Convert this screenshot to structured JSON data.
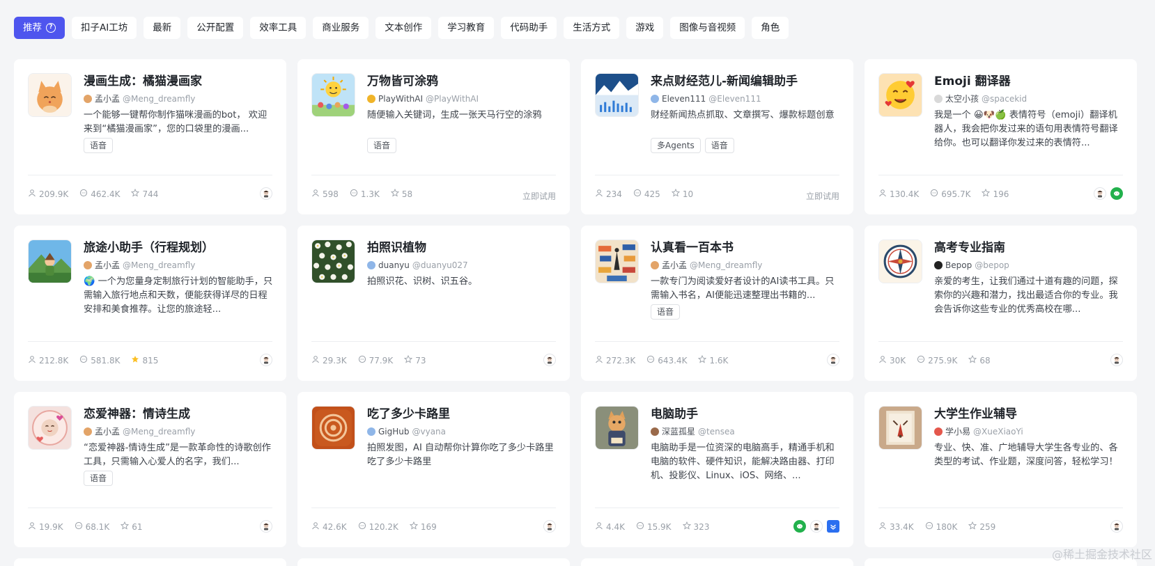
{
  "tabs": [
    {
      "label": "推荐",
      "active": true,
      "icon": "question-icon"
    },
    {
      "label": "扣子AI工坊"
    },
    {
      "label": "最新"
    },
    {
      "label": "公开配置"
    },
    {
      "label": "效率工具"
    },
    {
      "label": "商业服务"
    },
    {
      "label": "文本创作"
    },
    {
      "label": "学习教育"
    },
    {
      "label": "代码助手"
    },
    {
      "label": "生活方式"
    },
    {
      "label": "游戏"
    },
    {
      "label": "图像与音视频"
    },
    {
      "label": "角色"
    }
  ],
  "cards": [
    {
      "title": "漫画生成：橘猫漫画家",
      "author": "孟小孟",
      "handle": "@Meng_dreamfly",
      "desc": "一个能够一键帮你制作猫咪漫画的bot， 欢迎来到“橘猫漫画家”，您的口袋里的漫画...",
      "tags": [
        "语音"
      ],
      "users": "209.9K",
      "chats": "462.4K",
      "stars": "744",
      "starred": false,
      "try": "",
      "channels": [
        "robot"
      ],
      "thumb": "cat"
    },
    {
      "title": "万物皆可涂鸦",
      "author": "PlayWithAI",
      "handle": "@PlayWithAI",
      "desc": "随便输入关键词，生成一张天马行空的涂鸦",
      "tags": [
        "语音"
      ],
      "users": "598",
      "chats": "1.3K",
      "stars": "58",
      "starred": false,
      "try": "立即试用",
      "channels": [],
      "thumb": "doodle"
    },
    {
      "title": "来点财经范儿-新闻编辑助手",
      "author": "Eleven111",
      "handle": "@Eleven111",
      "desc": "财经新闻热点抓取、文章撰写、爆款标题创意",
      "tags": [
        "多Agents",
        "语音"
      ],
      "users": "234",
      "chats": "425",
      "stars": "10",
      "starred": false,
      "try": "立即试用",
      "channels": [],
      "thumb": "finance"
    },
    {
      "title": "Emoji 翻译器",
      "author": "太空小孩",
      "handle": "@spacekid",
      "desc": "我是一个 😀🐶🍏 表情符号（emoji）翻译机器人，我会把你发过来的语句用表情符号翻译给你。也可以翻译你发过来的表情符...",
      "tags": [],
      "users": "130.4K",
      "chats": "695.7K",
      "stars": "196",
      "starred": false,
      "try": "",
      "channels": [
        "robot",
        "wechat"
      ],
      "thumb": "emoji"
    },
    {
      "title": "旅途小助手（行程规划）",
      "author": "孟小孟",
      "handle": "@Meng_dreamfly",
      "desc": "🌍 一个为您量身定制旅行计划的智能助手，只需输入旅行地点和天数，便能获得详尽的日程安排和美食推荐。让您的旅途轻...",
      "tags": [],
      "users": "212.8K",
      "chats": "581.8K",
      "stars": "815",
      "starred": true,
      "try": "",
      "channels": [
        "robot"
      ],
      "thumb": "travel"
    },
    {
      "title": "拍照识植物",
      "author": "duanyu",
      "handle": "@duanyu027",
      "desc": "拍照识花、识树、识五谷。",
      "tags": [],
      "users": "29.3K",
      "chats": "77.9K",
      "stars": "73",
      "starred": false,
      "try": "",
      "channels": [
        "robot"
      ],
      "thumb": "plant"
    },
    {
      "title": "认真看一百本书",
      "author": "孟小孟",
      "handle": "@Meng_dreamfly",
      "desc": "一款专门为阅读爱好者设计的AI读书工具。只需输入书名，AI便能迅速整理出书籍的...",
      "tags": [
        "语音"
      ],
      "users": "272.3K",
      "chats": "643.4K",
      "stars": "1.6K",
      "starred": false,
      "try": "",
      "channels": [
        "robot"
      ],
      "thumb": "books"
    },
    {
      "title": "高考专业指南",
      "author": "Bepop",
      "handle": "@bepop",
      "desc": "亲爱的考生，让我们通过十道有趣的问题，探索你的兴趣和潜力，找出最适合你的专业。我会告诉你这些专业的优秀高校在哪...",
      "tags": [],
      "users": "30K",
      "chats": "275.9K",
      "stars": "68",
      "starred": false,
      "try": "",
      "channels": [
        "robot"
      ],
      "thumb": "compass"
    },
    {
      "title": "恋爱神器：情诗生成",
      "author": "孟小孟",
      "handle": "@Meng_dreamfly",
      "desc": "“恋爱神器-情诗生成”是一款革命性的诗歌创作工具，只需输入心爱人的名字，我们...",
      "tags": [
        "语音"
      ],
      "users": "19.9K",
      "chats": "68.1K",
      "stars": "61",
      "starred": false,
      "try": "",
      "channels": [
        "robot"
      ],
      "thumb": "love"
    },
    {
      "title": "吃了多少卡路里",
      "author": "GigHub",
      "handle": "@vyana",
      "desc": "拍照发图，AI 自动帮你计算你吃了多少卡路里 吃了多少卡路里",
      "tags": [],
      "users": "42.6K",
      "chats": "120.2K",
      "stars": "169",
      "starred": false,
      "try": "",
      "channels": [
        "robot"
      ],
      "thumb": "calorie"
    },
    {
      "title": "电脑助手",
      "author": "深蓝孤星",
      "handle": "@tensea",
      "desc": "电脑助手是一位资深的电脑高手，精通手机和电脑的软件、硬件知识，能解决路由器、打印机、投影仪、Linux、iOS、网络、...",
      "tags": [],
      "users": "4.4K",
      "chats": "15.9K",
      "stars": "323",
      "starred": false,
      "try": "",
      "channels": [
        "wechat",
        "robot",
        "feishu"
      ],
      "thumb": "pccat"
    },
    {
      "title": "大学生作业辅导",
      "author": "学小易",
      "handle": "@XueXiaoYi",
      "desc": "专业、快、准、广地辅导大学生各专业的、各类型的考试、作业题，深度问答，轻松学习！",
      "tags": [],
      "users": "33.4K",
      "chats": "180K",
      "stars": "259",
      "starred": false,
      "try": "",
      "channels": [
        "robot"
      ],
      "thumb": "homework"
    }
  ],
  "watermark": "@稀土掘金技术社区"
}
